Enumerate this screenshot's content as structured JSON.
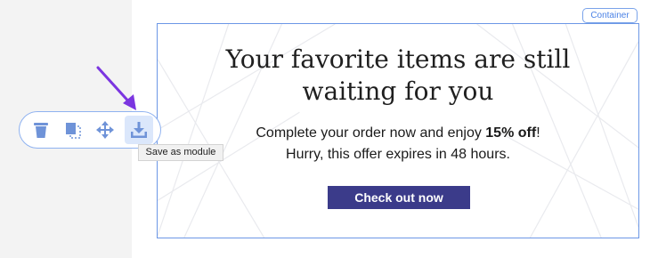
{
  "container_label": "Container",
  "email": {
    "headline_line1": "Your favorite items are still",
    "headline_line2": "waiting for you",
    "body_prefix": "Complete your order now and enjoy ",
    "body_bold": "15% off",
    "body_suffix": "!",
    "body_line2": "Hurry, this offer expires in 48 hours.",
    "cta_label": "Check out now"
  },
  "toolbar": {
    "tools": [
      "trash-icon",
      "duplicate-icon",
      "move-icon",
      "save-module-icon"
    ],
    "tooltip": "Save as module"
  },
  "colors": {
    "accent": "#4b82e6",
    "cta_bg": "#3b3b8a",
    "annotation_arrow": "#7b35e0"
  }
}
